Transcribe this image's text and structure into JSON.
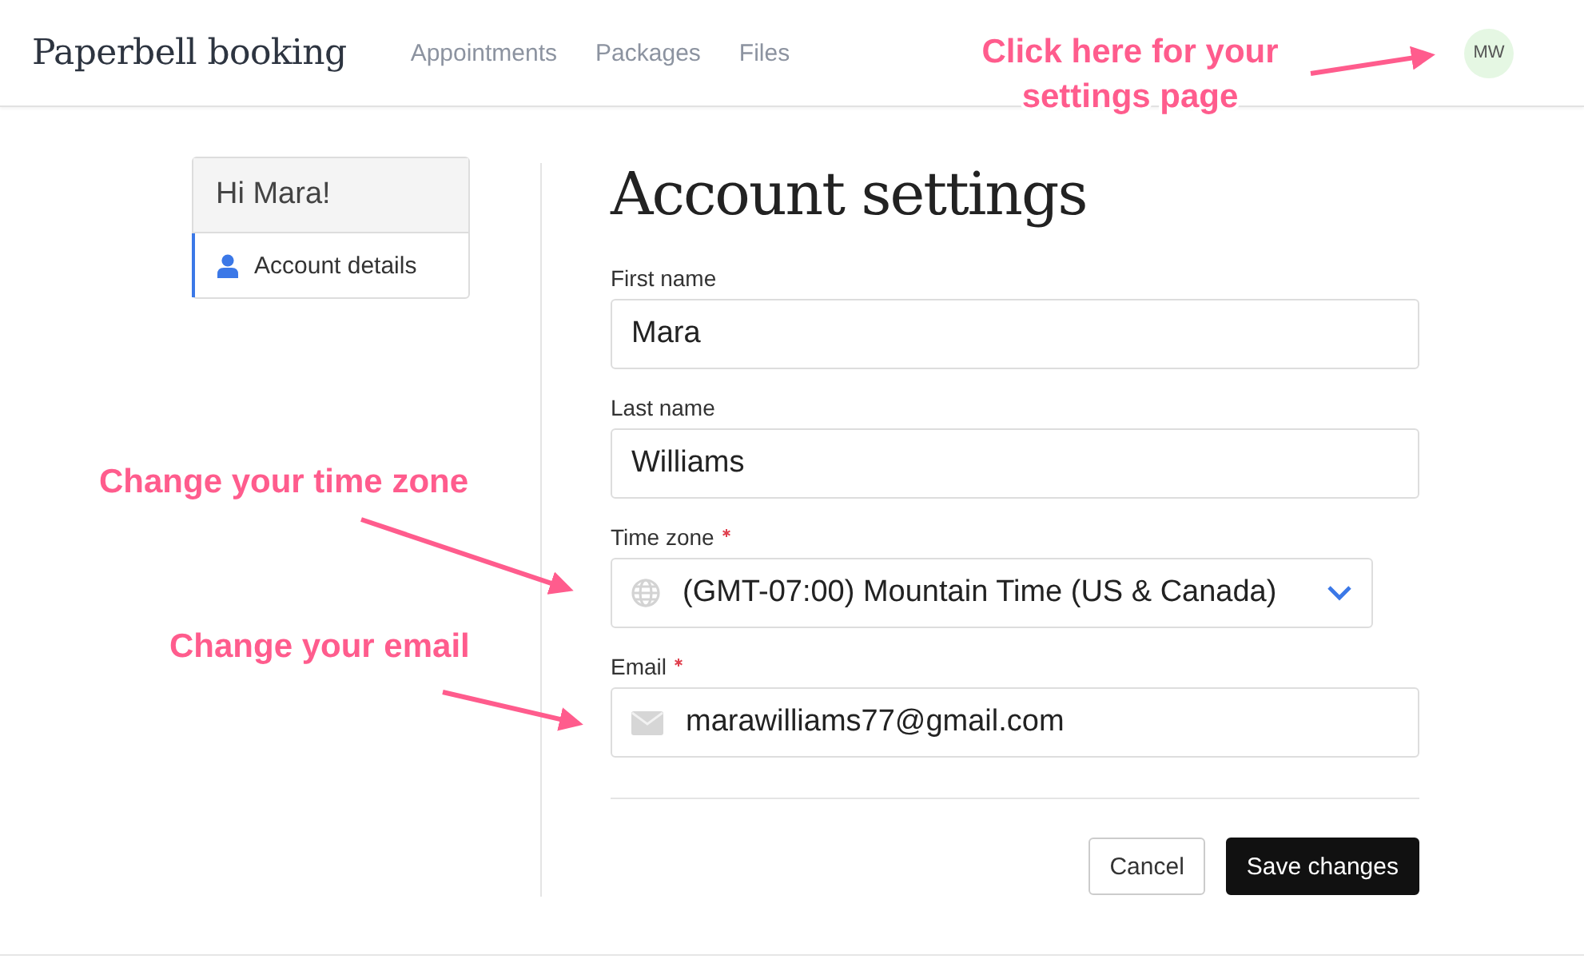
{
  "header": {
    "logo": "Paperbell booking",
    "nav": [
      {
        "label": "Appointments"
      },
      {
        "label": "Packages"
      },
      {
        "label": "Files"
      }
    ],
    "avatar": "MW"
  },
  "sidebar": {
    "greeting": "Hi Mara!",
    "items": [
      {
        "label": "Account details",
        "selected": true
      }
    ]
  },
  "main": {
    "title": "Account settings",
    "fields": [
      {
        "kind": "text",
        "label": "First name",
        "required": false,
        "value": "Mara"
      },
      {
        "kind": "text",
        "label": "Last name",
        "required": false,
        "value": "Williams"
      },
      {
        "kind": "select",
        "label": "Time zone",
        "required": true,
        "value": "(GMT-07:00) Mountain Time (US & Canada)"
      },
      {
        "kind": "email",
        "label": "Email",
        "required": true,
        "value": "marawilliams77@gmail.com"
      }
    ],
    "buttons": [
      {
        "kind": "secondary",
        "label": "Cancel"
      },
      {
        "kind": "primary",
        "label": "Save changes"
      }
    ]
  },
  "annotations": [
    {
      "text": "Click here for your settings page"
    },
    {
      "text": "Change your time zone"
    },
    {
      "text": "Change your email"
    }
  ]
}
